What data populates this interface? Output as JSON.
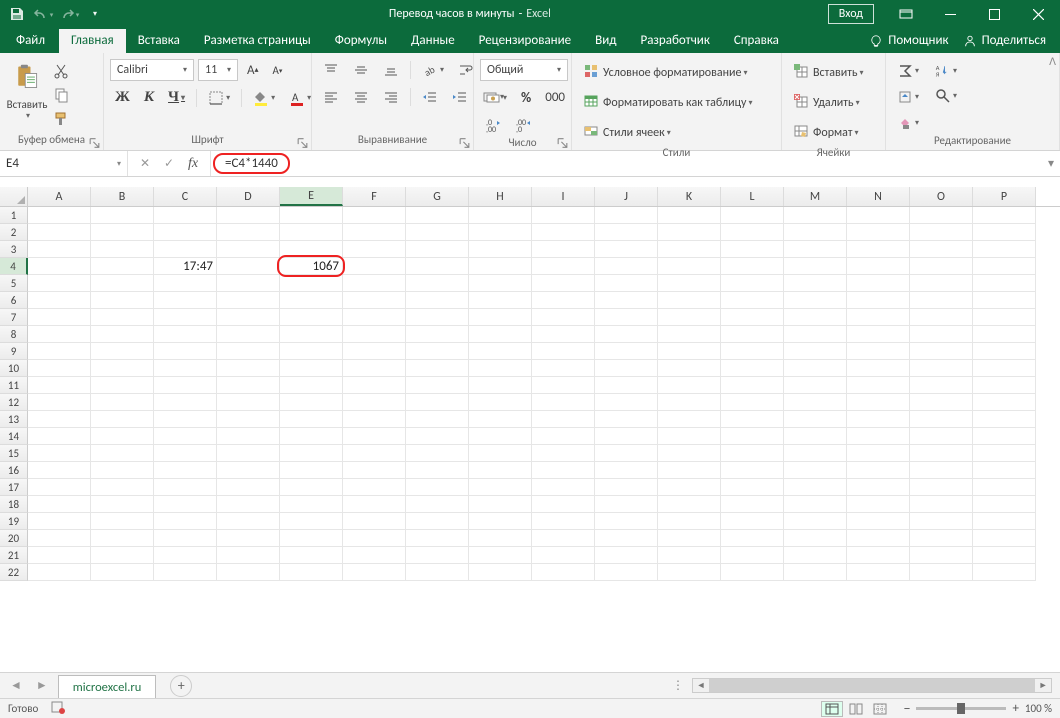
{
  "titlebar": {
    "doc": "Перевод часов в минуты",
    "app": "Excel",
    "signin": "Вход"
  },
  "tabs": {
    "file": "Файл",
    "list": [
      "Главная",
      "Вставка",
      "Разметка страницы",
      "Формулы",
      "Данные",
      "Рецензирование",
      "Вид",
      "Разработчик",
      "Справка"
    ],
    "active_index": 0,
    "tell": "Помощник",
    "share": "Поделиться"
  },
  "ribbon": {
    "clipboard": {
      "paste": "Вставить",
      "label": "Буфер обмена"
    },
    "font": {
      "name": "Calibri",
      "size": "11",
      "bold": "Ж",
      "italic": "К",
      "underline": "Ч",
      "label": "Шрифт"
    },
    "alignment": {
      "label": "Выравнивание"
    },
    "number": {
      "format": "Общий",
      "label": "Число"
    },
    "styles": {
      "cond": "Условное форматирование",
      "table": "Форматировать как таблицу",
      "cell": "Стили ячеек",
      "label": "Стили"
    },
    "cells": {
      "insert": "Вставить",
      "delete": "Удалить",
      "format": "Формат",
      "label": "Ячейки"
    },
    "editing": {
      "label": "Редактирование"
    }
  },
  "formula_bar": {
    "cellref": "E4",
    "formula": "=C4*1440"
  },
  "grid": {
    "columns": [
      "A",
      "B",
      "C",
      "D",
      "E",
      "F",
      "G",
      "H",
      "I",
      "J",
      "K",
      "L",
      "M",
      "N",
      "O",
      "P"
    ],
    "rows": 22,
    "active_col": "E",
    "active_row": 4,
    "cells": {
      "C4": "17:47",
      "E4": "1067"
    }
  },
  "sheet": {
    "name": "microexcel.ru"
  },
  "status": {
    "ready": "Готово",
    "zoom": "100 %"
  }
}
